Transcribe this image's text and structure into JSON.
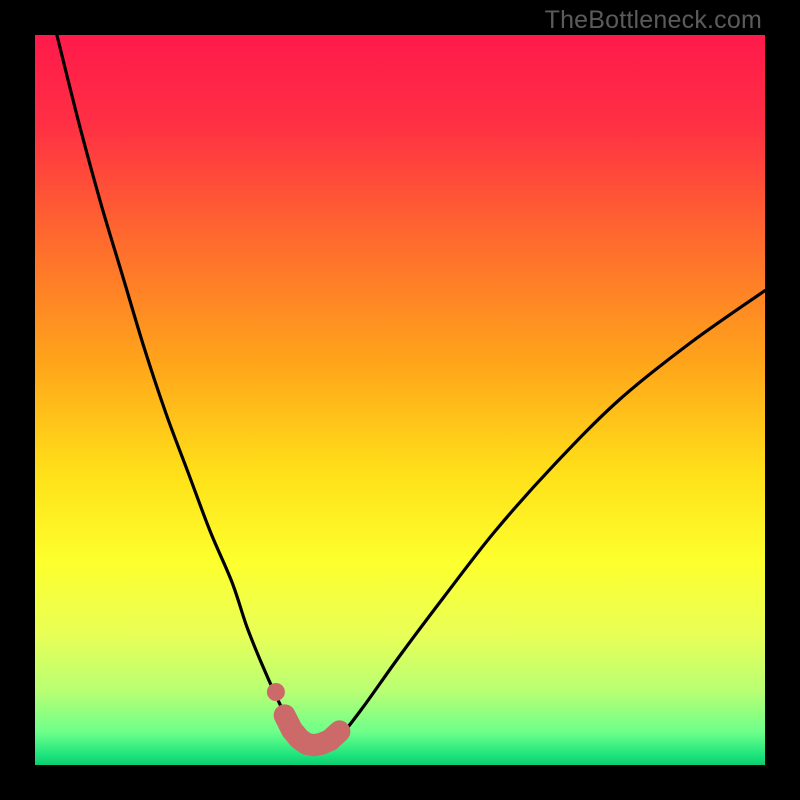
{
  "watermark": "TheBottleneck.com",
  "colors": {
    "frame": "#000000",
    "curve_stroke": "#000000",
    "marker_stroke": "#cc6a6a",
    "marker_fill": "#cc6a6a",
    "gradient_stops": [
      {
        "offset": 0.0,
        "color": "#ff1a4b"
      },
      {
        "offset": 0.12,
        "color": "#ff2f44"
      },
      {
        "offset": 0.28,
        "color": "#ff6a2e"
      },
      {
        "offset": 0.45,
        "color": "#ffa51a"
      },
      {
        "offset": 0.6,
        "color": "#ffe019"
      },
      {
        "offset": 0.72,
        "color": "#fdff2d"
      },
      {
        "offset": 0.82,
        "color": "#e9ff56"
      },
      {
        "offset": 0.9,
        "color": "#b7ff74"
      },
      {
        "offset": 0.955,
        "color": "#6dff8a"
      },
      {
        "offset": 0.985,
        "color": "#21e57d"
      },
      {
        "offset": 1.0,
        "color": "#0acf6f"
      }
    ]
  },
  "chart_data": {
    "type": "line",
    "title": "",
    "xlabel": "",
    "ylabel": "",
    "xlim": [
      0,
      100
    ],
    "ylim": [
      0,
      100
    ],
    "series": [
      {
        "name": "bottleneck-curve",
        "x": [
          3,
          6,
          9,
          12,
          15,
          18,
          21,
          24,
          27,
          29,
          31,
          33,
          34.5,
          36,
          37.3,
          38.5,
          40,
          42,
          45,
          50,
          56,
          63,
          71,
          80,
          90,
          100
        ],
        "y": [
          100,
          88,
          77,
          67,
          57,
          48,
          40,
          32,
          25,
          19,
          14,
          9.5,
          6.5,
          4.3,
          3.1,
          2.7,
          2.9,
          4.2,
          8.0,
          15,
          23,
          32,
          41,
          50,
          58,
          65
        ]
      }
    ],
    "markers": {
      "name": "optimal-range",
      "x": [
        34.2,
        35.2,
        36.2,
        37.2,
        38.2,
        39.2,
        40.4,
        41.7
      ],
      "y": [
        6.8,
        4.8,
        3.6,
        2.9,
        2.7,
        2.9,
        3.4,
        4.6
      ]
    },
    "extra_marker": {
      "x": 33.0,
      "y": 10.0
    }
  }
}
